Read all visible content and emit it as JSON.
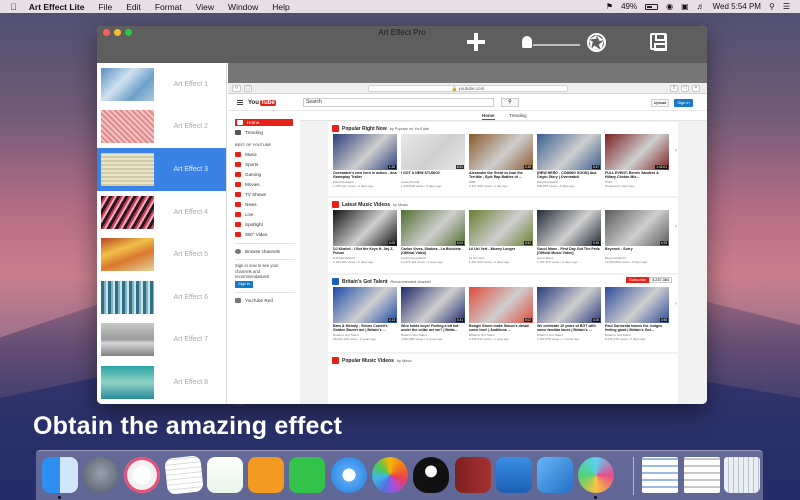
{
  "menubar": {
    "app_name": "Art Effect Lite",
    "items": [
      "File",
      "Edit",
      "Format",
      "View",
      "Window",
      "Help"
    ],
    "battery": "49%",
    "clock": "Wed 5:54 PM"
  },
  "window": {
    "title": "Art Effect Pro",
    "toolbar_icons": [
      "plus-icon",
      "brightness-slider-icon",
      "shutter-icon",
      "save-icon"
    ],
    "brightness_level": 0
  },
  "effects": [
    {
      "label": "Art Effect 1",
      "selected": false
    },
    {
      "label": "Art Effect 2",
      "selected": false
    },
    {
      "label": "Art Effect 3",
      "selected": true
    },
    {
      "label": "Art Effect 4",
      "selected": false
    },
    {
      "label": "Art Effect 5",
      "selected": false
    },
    {
      "label": "Art Effect 6",
      "selected": false
    },
    {
      "label": "Art Effect 7",
      "selected": false
    },
    {
      "label": "Art Effect 8",
      "selected": false
    }
  ],
  "browser": {
    "url": "youtube.com"
  },
  "youtube": {
    "logo_you": "You",
    "logo_tube": "Tube",
    "search_placeholder": "Search",
    "upload": "Upload",
    "sign_in": "Sign in",
    "nav": {
      "home": "Home",
      "trending": "Trending",
      "best_of": "BEST OF YOUTUBE",
      "items": [
        "Music",
        "Sports",
        "Gaming",
        "Movies",
        "TV Shows",
        "News",
        "Live",
        "Spotlight",
        "360° Video"
      ],
      "browse": "Browse channels",
      "signin_note": "Sign in now to see your channels and recommendations!",
      "signin_button": "Sign in",
      "red": "YouTube Red"
    },
    "tabs": [
      "Home",
      "Trending"
    ],
    "sections": [
      {
        "title": "Popular Right Now",
        "by": "by Popular on YouTube",
        "videos": [
          {
            "title": "Overwatch's new hero in action - Ana Gameplay Trailer",
            "meta": "PlayOverwatch",
            "views": "1,035,121 views • 3 days ago",
            "dur": "1:28"
          },
          {
            "title": "I GOT A NEW STUDIO!!",
            "meta": "CaseyNeistat",
            "views": "1,448,818 views • 3 days ago",
            "dur": "8:51"
          },
          {
            "title": "Alexander the Great vs Ivan the Terrible - Epic Rap Battles of ...",
            "meta": "ERB",
            "views": "2,937,920 views • 1 day ago",
            "dur": "2:48"
          },
          {
            "title": "[NEW HERO - COMING SOON] Ana Origin Story | Overwatch",
            "meta": "PlayOverwatch",
            "views": "526,953 views • 3 days ago",
            "dur": "3:47"
          },
          {
            "title": "FULL EVENT: Bernie Sanders & Hillary Clinton Mix...",
            "meta": "CNN",
            "views": "Streamed 1 days ago",
            "dur": "1:42:01"
          }
        ]
      },
      {
        "title": "Latest Music Videos",
        "by": "by Music",
        "videos": [
          {
            "title": "DJ Khaled - I Got the Keys ft. Jay Z, Future",
            "meta": "DJKhaledVEVO",
            "views": "1,294,901 views • 2 days ago",
            "dur": "4:06"
          },
          {
            "title": "Carlos Vives, Shakira - La Bicicleta (Official Video)",
            "meta": "CarlosVivesVEVO",
            "views": "13,472,113 views • 2 days ago",
            "dur": "4:04"
          },
          {
            "title": "Lil Uzi Vert - Money Longer",
            "meta": "Lil Uzi Vert",
            "views": "1,401,924 views • 2 days ago",
            "dur": "3:52"
          },
          {
            "title": "Gucci Mane - First Day Out The Feds [Official Music Video]",
            "meta": "Gucci Mane",
            "views": "1,781,574 views • 2 days ago",
            "dur": "3:45"
          },
          {
            "title": "Beyoncé - Sorry",
            "meta": "BeyonceVEVO",
            "views": "10,460,899 views • 2 days ago",
            "dur": "4:25"
          }
        ]
      },
      {
        "title": "Britain's Got Talent",
        "by": "Recommended channel",
        "subscribe": "Subscribe",
        "subscribers": "3,237,384",
        "videos": [
          {
            "title": "Bars & Melody - Simon Cowell's Golden Buzzer act | Britain's ...",
            "meta": "Britain's Got Talent",
            "views": "99,034,128 views • 2 years ago",
            "dur": "3:13"
          },
          {
            "title": "Who holds boys! Feeling a bit hot under the collar are we? | Britai...",
            "meta": "Britain's Got Talent",
            "views": "4,362,882 views • 2 years ago",
            "dur": "3:41"
          },
          {
            "title": "Boogie Storm make Simon's dream come true! | Auditions ...",
            "meta": "Britain's Got Talent",
            "views": "2,648,513 views • 1 year ago",
            "dur": "5:02"
          },
          {
            "title": "We celebrate 10 years of BGT with some familiar faces | Britain's ...",
            "meta": "Britain's Got Talent",
            "views": "1,362,878 views • 1 month ago",
            "dur": "3:26"
          },
          {
            "title": "Paul Sormenta leaves the Judges feeling good | Britain's Got...",
            "meta": "Britain's Got Talent",
            "views": "8,041,979 views • 2 days ago",
            "dur": "3:58"
          }
        ]
      },
      {
        "title": "Popular Music Videos",
        "by": "by Music",
        "videos": []
      }
    ]
  },
  "caption": "Obtain the amazing effect",
  "dock": {
    "icons": [
      "finder-icon",
      "launchpad-icon",
      "itunes-icon",
      "textedit-icon",
      "numbers-icon",
      "ibooks-icon",
      "facetime-icon",
      "safari-icon",
      "photos-icon",
      "qq-icon",
      "dictionary-icon",
      "keynote-icon",
      "xcode-icon",
      "art-effect-icon",
      "document-stack-icon",
      "trash-icon"
    ]
  }
}
